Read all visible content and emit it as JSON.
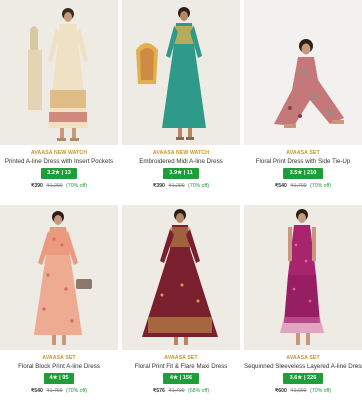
{
  "products": [
    {
      "brand": "AVAASA NEW WATCH",
      "name": "Printed A-line Dress with Insert Pockets",
      "rating": "3.2★ | 13",
      "price": "₹390",
      "mrp": "₹1,299",
      "discount": "(70% off)",
      "colors": {
        "bg": "#eeeae4",
        "dress": "#efe1c4",
        "accent": "#d4a15e",
        "pattern": "#b5443f"
      }
    },
    {
      "brand": "AVAASA NEW WATCH",
      "name": "Embroidered Midi A-line Dress",
      "rating": "3.9★ | 11",
      "price": "₹390",
      "mrp": "₹1,299",
      "discount": "(70% off)",
      "colors": {
        "bg": "#eeeae4",
        "dress": "#2e9a8a",
        "accent": "#e0b14e",
        "pattern": "#c77a3f"
      }
    },
    {
      "brand": "AVAASA SET",
      "name": "Floral Print Dress with Side Tie-Up",
      "rating": "3.5★ | 210",
      "price": "₹540",
      "mrp": "₹1,799",
      "discount": "(70% off)",
      "colors": {
        "bg": "#f2f1ef",
        "dress": "#c4787a",
        "accent": "#6f9c94",
        "pattern": "#8a3f47"
      }
    },
    {
      "brand": "AVAASA SET",
      "name": "Floral Block Print A-line Dress",
      "rating": "4★ | 95",
      "price": "₹540",
      "mrp": "₹1,799",
      "discount": "(70% off)",
      "colors": {
        "bg": "#eeeae4",
        "dress": "#ec9a7f",
        "accent": "#f4c2a8",
        "pattern": "#d86a5a"
      }
    },
    {
      "brand": "AVAASA SET",
      "name": "Floral Print Fit & Flare Maxi Dress",
      "rating": "4★ | 156",
      "price": "₹576",
      "mrp": "₹1,799",
      "discount": "(68% off)",
      "colors": {
        "bg": "#eeeae4",
        "dress": "#7a1f2e",
        "accent": "#c9a34e",
        "pattern": "#5a1522"
      }
    },
    {
      "brand": "AVAASA SET",
      "name": "Sequinned Sleeveless Layered A-line Dress",
      "rating": "3.6★ | 226",
      "price": "₹600",
      "mrp": "₹1,999",
      "discount": "(70% off)",
      "colors": {
        "bg": "#eeeae4",
        "dress": "#a8246e",
        "accent": "#d86aa8",
        "pattern": "#7b1450"
      }
    }
  ]
}
